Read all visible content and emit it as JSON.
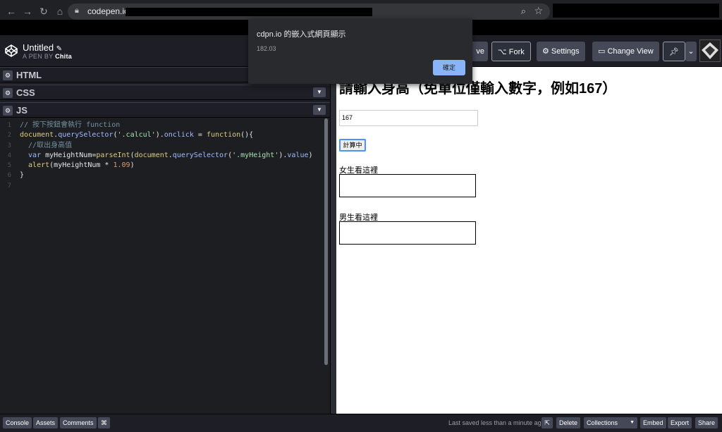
{
  "browser": {
    "url": "codepen.io/",
    "lock_icon": "lock-icon",
    "back_icon": "arrow-left-icon",
    "forward_icon": "arrow-right-icon",
    "reload_icon": "reload-icon",
    "home_icon": "home-icon"
  },
  "header": {
    "pen_title": "Untitled",
    "pen_by_prefix": "A PEN BY",
    "author": "Chita",
    "save_label": "ve",
    "fork_label": "Fork",
    "settings_label": "Settings",
    "change_view_label": "Change View"
  },
  "panels": {
    "html_label": "HTML",
    "css_label": "CSS",
    "js_label": "JS"
  },
  "code": {
    "line_numbers": [
      "1",
      "2",
      "3",
      "4",
      "5",
      "6",
      "7"
    ],
    "line1": "// 按下按鈕會執行 function",
    "line2_a": "document",
    "line2_b": ".",
    "line2_c": "querySelector",
    "line2_d": "(",
    "line2_e": "'.calcul'",
    "line2_f": ").",
    "line2_g": "onclick",
    "line2_h": " = ",
    "line2_i": "function",
    "line2_j": "(){",
    "line3": "  //取出身高值",
    "line4_a": "  var ",
    "line4_b": "myHeightNum",
    "line4_c": "=",
    "line4_d": "parseInt",
    "line4_e": "(",
    "line4_f": "document",
    "line4_g": ".",
    "line4_h": "querySelector",
    "line4_i": "(",
    "line4_j": "'.myHeight'",
    "line4_k": ").",
    "line4_l": "value",
    "line4_m": ")",
    "line5_a": "  alert",
    "line5_b": "(myHeightNum * ",
    "line5_c": "1.09",
    "line5_d": ")",
    "line6": "}"
  },
  "preview": {
    "heading": "請輸入身高（免單位僅輸入數字，例如167）",
    "input_value": "167",
    "button_label": "計算中",
    "female_label": "女生看這裡",
    "male_label": "男生看這裡"
  },
  "dialog": {
    "title": "cdpn.io 的嵌入式網頁顯示",
    "message": "182.03",
    "ok_label": "確定"
  },
  "footer": {
    "console": "Console",
    "assets": "Assets",
    "comments": "Comments",
    "shortcut": "⌘",
    "last_saved": "Last saved less than a minute ago",
    "delete": "Delete",
    "collections": "Collections",
    "embed": "Embed",
    "export": "Export",
    "share": "Share"
  }
}
